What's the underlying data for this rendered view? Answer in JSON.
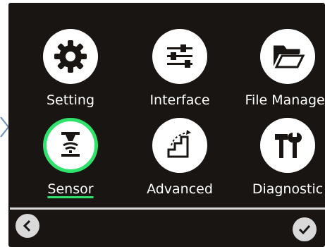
{
  "menu": {
    "items": [
      {
        "label": "Setting",
        "icon": "gear-icon"
      },
      {
        "label": "Interface",
        "icon": "sliders-icon"
      },
      {
        "label": "File Manager",
        "icon": "folder-icon"
      },
      {
        "label": "Sensor",
        "icon": "sensor-icon",
        "selected": true
      },
      {
        "label": "Advanced",
        "icon": "stairs-icon"
      },
      {
        "label": "Diagnostic",
        "icon": "tools-icon"
      }
    ]
  },
  "nav": {
    "back_icon": "chevron-left-icon",
    "ok_icon": "check-icon"
  },
  "colors": {
    "background": "#191512",
    "accent": "#2ee26b",
    "icon_bg": "#ffffff",
    "nav_bg": "#d9d9d9"
  }
}
